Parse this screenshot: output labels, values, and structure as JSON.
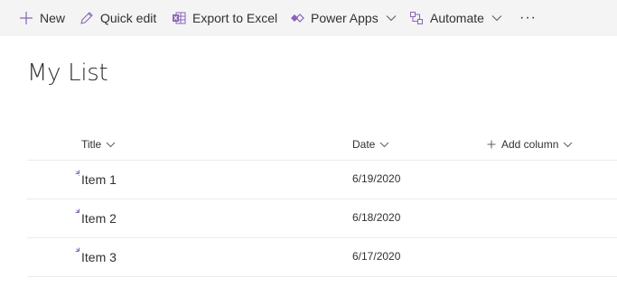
{
  "commandbar": {
    "new_label": "New",
    "quick_edit_label": "Quick edit",
    "export_label": "Export to Excel",
    "power_apps_label": "Power Apps",
    "automate_label": "Automate",
    "more_label": "···"
  },
  "page": {
    "title": "My List"
  },
  "columns": {
    "title": "Title",
    "date": "Date",
    "add_column": "Add column"
  },
  "rows": [
    {
      "title": "Item 1",
      "date": "6/19/2020",
      "status_icon": "new-item-icon"
    },
    {
      "title": "Item 2",
      "date": "6/18/2020",
      "status_icon": "new-item-icon"
    },
    {
      "title": "Item 3",
      "date": "6/17/2020",
      "status_icon": "new-item-icon"
    }
  ],
  "colors": {
    "accent": "#8764b8",
    "command_bar_bg": "#f4f4f4",
    "divider": "#edebe9",
    "text": "#323130"
  }
}
